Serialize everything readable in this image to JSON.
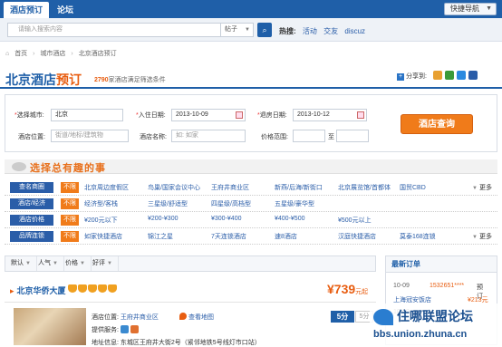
{
  "topbar": {
    "tabs": [
      "酒店预订",
      "论坛"
    ],
    "quick_nav": "快捷导航"
  },
  "search": {
    "placeholder": "请输入搜索内容",
    "type": "帖子",
    "hot_label": "热搜:",
    "hot_terms": [
      "活动",
      "交友",
      "discuz"
    ]
  },
  "breadcrumb": [
    "首页",
    "城市酒店",
    "北京酒店预订"
  ],
  "page": {
    "title_city": "北京酒店",
    "title_suffix": "预订",
    "count": "2790",
    "count_text": "家酒店满足筛选条件",
    "share_label": "分享到:"
  },
  "form": {
    "city_label": "选择城市:",
    "city_value": "北京",
    "checkin_label": "入住日期:",
    "checkin_value": "2013-10-09",
    "checkout_label": "退房日期:",
    "checkout_value": "2013-10-12",
    "location_label": "酒店位置:",
    "location_placeholder": "街道/地标/建筑物",
    "name_label": "酒店名称:",
    "name_placeholder": "如: 如家",
    "price_label": "价格范围:",
    "price_sep": "至",
    "submit": "酒店查询"
  },
  "fun_banner": "选择总有趣的事",
  "filters": [
    {
      "cat": "查名商圈",
      "any": "不限",
      "opts": [
        "北京周边度假区",
        "鸟巢/国家会议中心",
        "王府井商业区",
        "新燕/后海/新街口",
        "北京展览馆/首都体",
        "国贸CBD"
      ],
      "more": "更多"
    },
    {
      "cat": "酒店/经济",
      "any": "不限",
      "opts": [
        "经济型/客栈",
        "三星级/舒适型",
        "四星级/高档型",
        "五星级/豪华型"
      ],
      "more": ""
    },
    {
      "cat": "酒店价格",
      "any": "不限",
      "opts": [
        "¥200元以下",
        "¥200-¥300",
        "¥300-¥400",
        "¥400-¥500",
        "¥500元以上"
      ],
      "more": ""
    },
    {
      "cat": "品牌连锁",
      "any": "不限",
      "opts": [
        "如家快捷酒店",
        "锦江之星",
        "7天连锁酒店",
        "速8酒店",
        "汉庭快捷酒店",
        "莫泰168连锁"
      ],
      "more": "更多"
    }
  ],
  "sort": [
    "默认",
    "人气",
    "价格",
    "好评"
  ],
  "hotel": {
    "name": "北京华侨大厦",
    "price": "¥739",
    "price_suffix": "元起",
    "location_label": "酒店位置:",
    "location_value": "王府井商业区",
    "map": "查看地图",
    "services_label": "提供服务:",
    "address_label": "地址信息:",
    "address_value": "东城区王府井大街2号（紧邻地铁5号线灯市口站）",
    "score": "5分",
    "score2": "5分"
  },
  "recent": {
    "title": "最新订单",
    "orders": [
      {
        "date": "10-09",
        "num": "1532651****",
        "act": "预订",
        "hotel": "上海冠安饭店",
        "price": "¥213元"
      },
      {
        "date": "10-09",
        "num": "",
        "act": "",
        "hotel": "",
        "price": ""
      }
    ]
  },
  "watermark": {
    "title": "住哪联盟论坛",
    "url": "bbs.union.zhuna.cn"
  },
  "colors": {
    "brand": "#1f5fa8",
    "accent": "#e85d10"
  }
}
